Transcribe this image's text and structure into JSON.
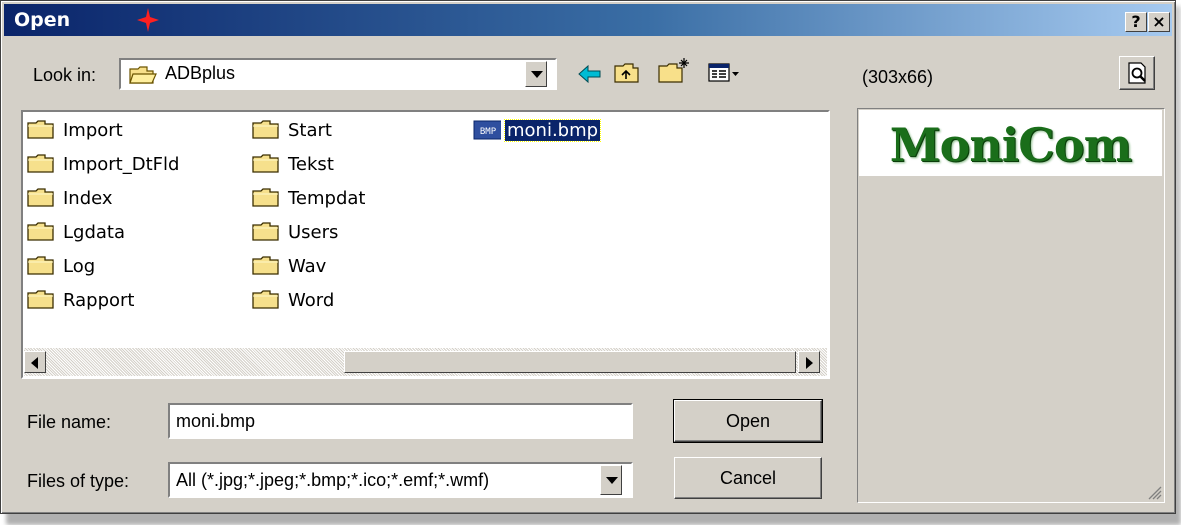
{
  "window": {
    "title": "Open",
    "help_label": "?",
    "close_label": "×"
  },
  "lookin": {
    "label": "Look in:",
    "value": "ADBplus"
  },
  "preview": {
    "dimensions": "(303x66)",
    "image_text": "MoniCom"
  },
  "files": [
    {
      "name": "Import",
      "type": "folder"
    },
    {
      "name": "Import_DtFld",
      "type": "folder"
    },
    {
      "name": "Index",
      "type": "folder"
    },
    {
      "name": "Lgdata",
      "type": "folder"
    },
    {
      "name": "Log",
      "type": "folder"
    },
    {
      "name": "Rapport",
      "type": "folder"
    },
    {
      "name": "Start",
      "type": "folder"
    },
    {
      "name": "Tekst",
      "type": "folder"
    },
    {
      "name": "Tempdat",
      "type": "folder"
    },
    {
      "name": "Users",
      "type": "folder"
    },
    {
      "name": "Wav",
      "type": "folder"
    },
    {
      "name": "Word",
      "type": "folder"
    },
    {
      "name": "moni.bmp",
      "type": "bmp",
      "icon_text": "BMP",
      "selected": true
    }
  ],
  "filename": {
    "label": "File name:",
    "value": "moni.bmp"
  },
  "filetype": {
    "label": "Files of type:",
    "value": "All (*.jpg;*.jpeg;*.bmp;*.ico;*.emf;*.wmf)"
  },
  "buttons": {
    "open": "Open",
    "cancel": "Cancel"
  },
  "colors": {
    "titlebar_start": "#0a246a",
    "titlebar_end": "#a6caf0",
    "selection": "#0a246a",
    "preview_text": "#1a6e1a"
  }
}
